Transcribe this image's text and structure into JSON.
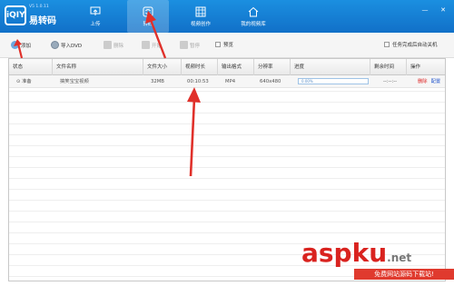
{
  "app": {
    "logo": "iQIY",
    "name": "易转码",
    "version": "V5 1.0.11"
  },
  "nav": [
    {
      "label": "上传",
      "icon": "upload-icon"
    },
    {
      "label": "转码",
      "icon": "transcode-icon"
    },
    {
      "label": "视频创作",
      "icon": "video-create-icon"
    },
    {
      "label": "我的视频库",
      "icon": "home-icon"
    }
  ],
  "window": {
    "minimize": "—",
    "close": "✕"
  },
  "toolbar": {
    "add": "添加",
    "import_dvd": "导入DVD",
    "delete": "删除",
    "start": "开始",
    "pause": "暂停",
    "preview": "预览",
    "auto_shutdown": "任务完成后自动关机"
  },
  "table": {
    "columns": [
      "状态",
      "文件名称",
      "文件大小",
      "视频时长",
      "输出格式",
      "分辨率",
      "进度",
      "剩余时间",
      "操作"
    ],
    "rows": [
      {
        "status": "⊙ 准备",
        "filename": "搞笑宝宝视频",
        "size": "32MB",
        "duration": "00:10:53",
        "format": "MP4",
        "resolution": "640x480",
        "progress_text": "0.00%",
        "progress": 0,
        "remaining": "--:--:--",
        "action_delete": "删除",
        "action_config": "配置"
      }
    ]
  },
  "watermark": {
    "text": "aspku",
    "suffix": ".net",
    "sub": "免费网站源码下载站!"
  },
  "colors": {
    "header": "#1170c8",
    "arrow": "#e0302a",
    "watermark": "#d9231f"
  }
}
